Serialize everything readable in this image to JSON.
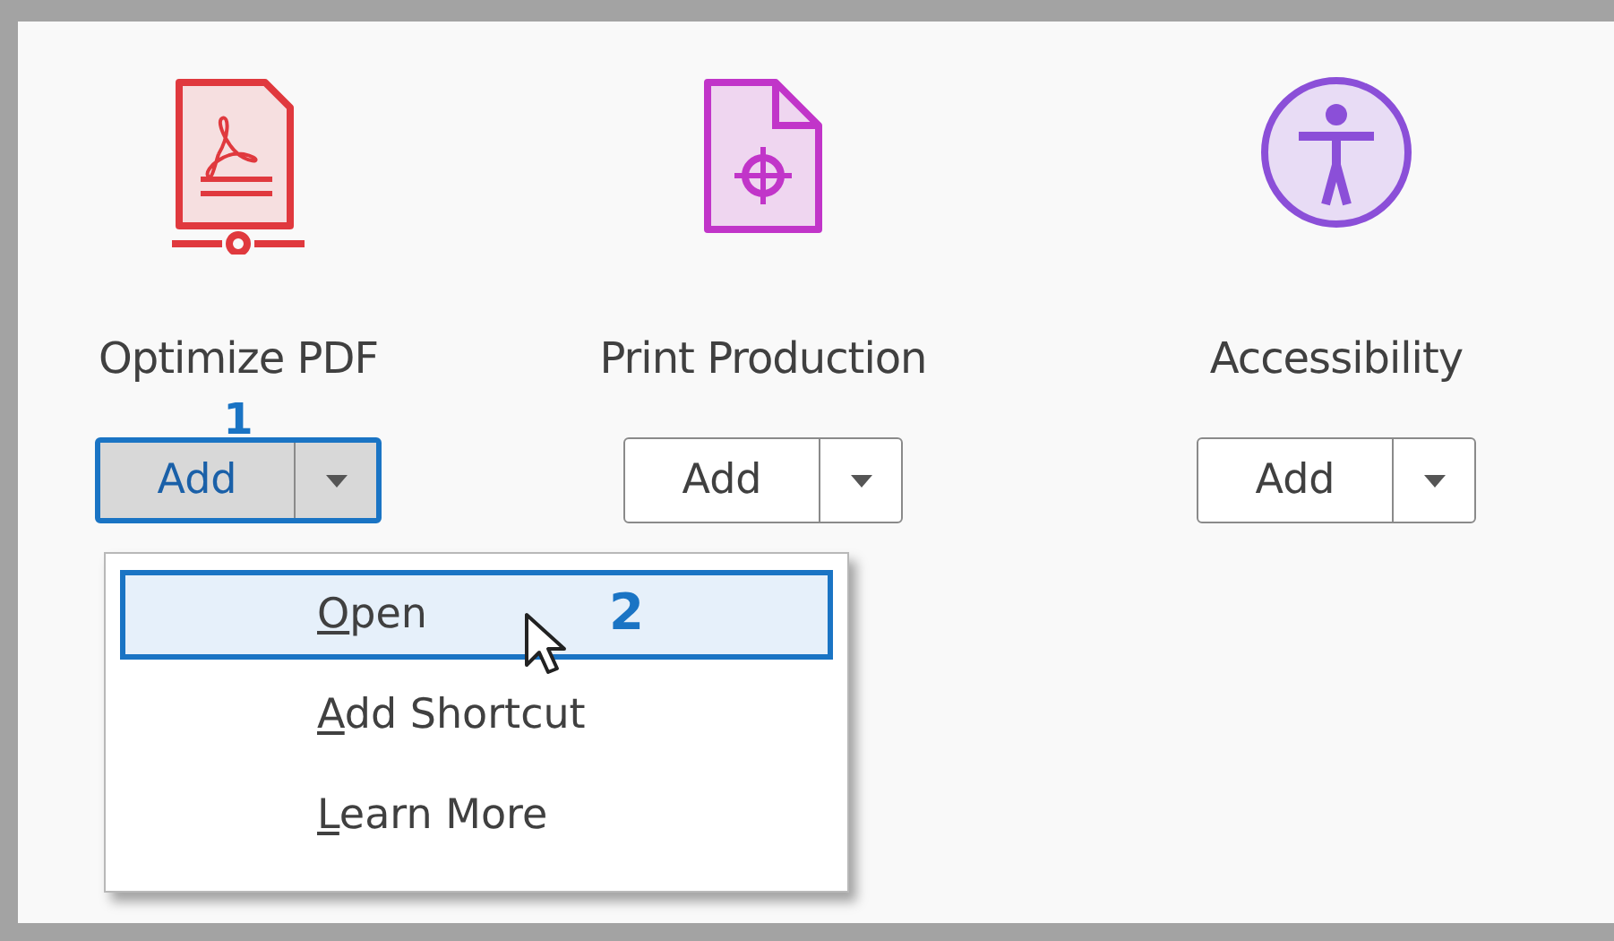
{
  "tools": [
    {
      "kind": "optimize",
      "title": "Optimize PDF",
      "button": "Add",
      "pressed": true,
      "callout": "1"
    },
    {
      "kind": "print",
      "title": "Print Production",
      "button": "Add",
      "pressed": false
    },
    {
      "kind": "accessibility",
      "title": "Accessibility",
      "button": "Add",
      "pressed": false
    }
  ],
  "menu": {
    "callout": "2",
    "items": [
      {
        "label": "Open",
        "selected": true
      },
      {
        "label": "Add Shortcut",
        "selected": false
      },
      {
        "label": "Learn More",
        "selected": false
      }
    ]
  }
}
